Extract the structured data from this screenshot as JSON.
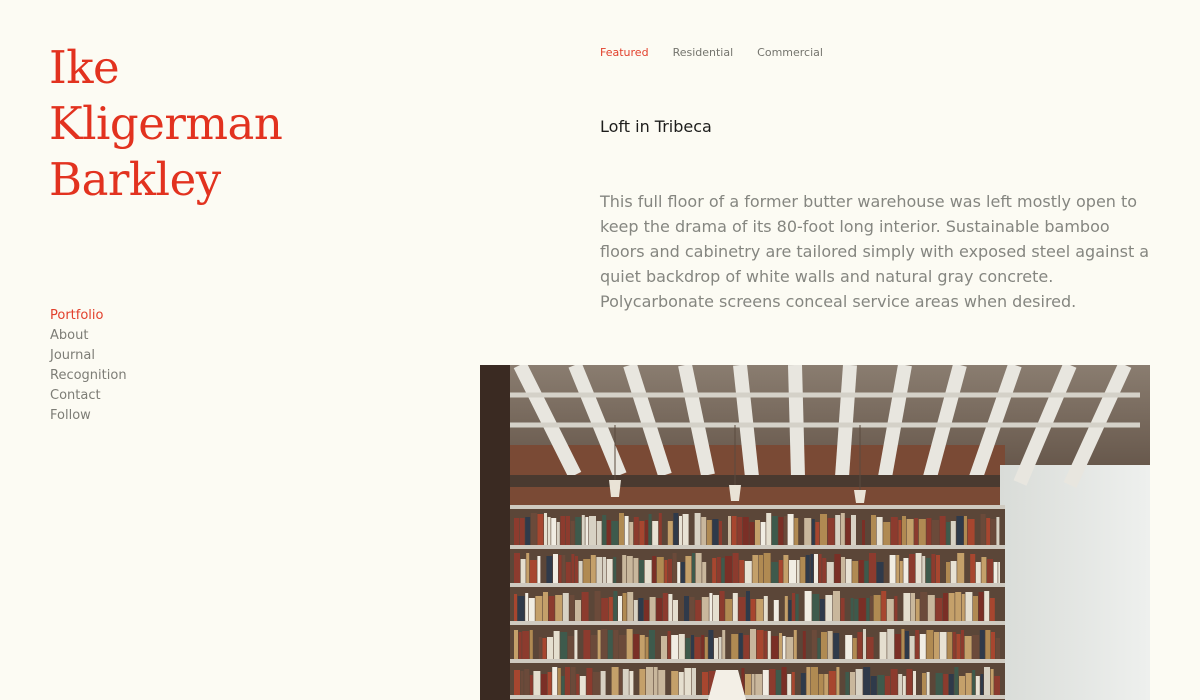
{
  "brand": {
    "line1": "Ike",
    "line2": "Kligerman",
    "line3": "Barkley",
    "color": "#e2321f"
  },
  "side_nav": {
    "items": [
      {
        "label": "Portfolio",
        "active": true
      },
      {
        "label": "About",
        "active": false
      },
      {
        "label": "Journal",
        "active": false
      },
      {
        "label": "Recognition",
        "active": false
      },
      {
        "label": "Contact",
        "active": false
      },
      {
        "label": "Follow",
        "active": false
      }
    ]
  },
  "category_nav": {
    "items": [
      {
        "label": "Featured",
        "active": true
      },
      {
        "label": "Residential",
        "active": false
      },
      {
        "label": "Commercial",
        "active": false
      }
    ]
  },
  "project": {
    "title": "Loft in Tribeca",
    "description": "This full floor of a former butter warehouse was left mostly open to keep the drama of its 80-foot long interior. Sustainable bamboo floors and cabinetry are tailored simply with exposed steel against a quiet backdrop of white walls and natural gray concrete. Polycarbonate screens conceal service areas when desired."
  },
  "colors": {
    "background": "#fcfbf3",
    "accent": "#e2402c",
    "muted_text": "#7d7d76"
  }
}
